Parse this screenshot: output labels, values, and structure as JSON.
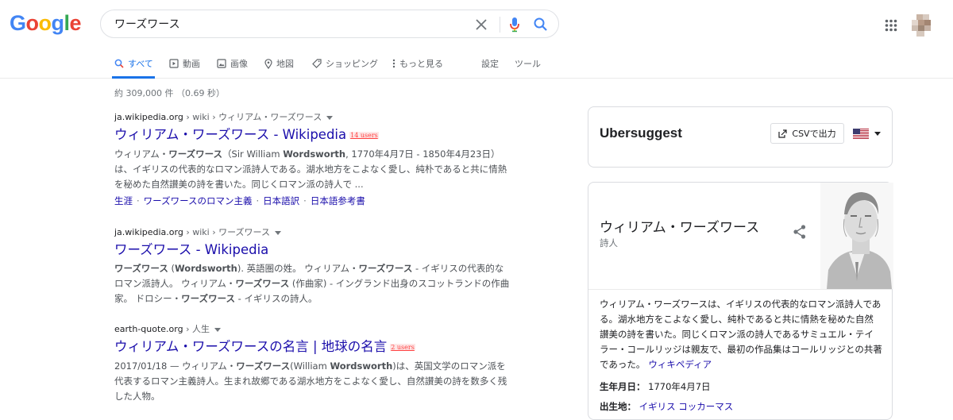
{
  "logo": {
    "letters": [
      "G",
      "o",
      "o",
      "g",
      "l",
      "e"
    ],
    "colors": [
      "#4285f4",
      "#ea4335",
      "#fbbc05",
      "#4285f4",
      "#34a853",
      "#ea4335"
    ]
  },
  "search": {
    "value": "ワーズワース"
  },
  "tabs": [
    {
      "label": "すべて",
      "icon": "search-icon",
      "active": true
    },
    {
      "label": "動画",
      "icon": "video-icon"
    },
    {
      "label": "画像",
      "icon": "image-icon"
    },
    {
      "label": "地図",
      "icon": "map-pin-icon"
    },
    {
      "label": "ショッピング",
      "icon": "tag-icon"
    },
    {
      "label": "もっと見る",
      "icon": "more-vert-icon"
    },
    {
      "label": "設定"
    },
    {
      "label": "ツール"
    }
  ],
  "stats": "約 309,000 件 （0.69 秒）",
  "results": [
    {
      "domain": "ja.wikipedia.org",
      "path": " › wiki › ウィリアム・ワーズワース",
      "title": "ウィリアム・ワーズワース - Wikipedia",
      "badge": "14 users",
      "snippet_html": "ウィリアム・<b>ワーズワース</b>（Sir William <b>Wordsworth</b>, 1770年4月7日 - 1850年4月23日）は、イギリスの代表的なロマン派詩人である。湖水地方をこよなく愛し、純朴であると共に情熱を秘めた自然讃美の詩を書いた。同じくロマン派の詩人で ...",
      "sitelinks": [
        "生涯",
        "ワーズワースのロマン主義",
        "日本語訳",
        "日本語参考書"
      ]
    },
    {
      "domain": "ja.wikipedia.org",
      "path": " › wiki › ワーズワース",
      "title": "ワーズワース - Wikipedia",
      "snippet_html": "<b>ワーズワース</b> (<b>Wordsworth</b>). 英語圏の姓。 ウィリアム・<b>ワーズワース</b> - イギリスの代表的なロマン派詩人。 ウィリアム・<b>ワーズワース</b> (作曲家) - イングランド出身のスコットランドの作曲家。 ドロシー・<b>ワーズワース</b> - イギリスの詩人。"
    },
    {
      "domain": "earth-quote.org",
      "path": " › 人生",
      "title": "ウィリアム・ワーズワースの名言 | 地球の名言",
      "badge": "2 users",
      "snippet_html": "2017/01/18 — ウィリアム・<b>ワーズワース</b>(William <b>Wordsworth</b>)は、英国文学のロマン派を代表するロマン主義詩人。生まれ故郷である湖水地方をこよなく愛し、自然讃美の詩を数多く残した人物。"
    }
  ],
  "ubersuggest": {
    "title": "Ubersuggest",
    "csv_label": "CSVで出力"
  },
  "knowledge_panel": {
    "name": "ウィリアム・ワーズワース",
    "subtitle": "詩人",
    "description": "ウィリアム・ワーズワースは、イギリスの代表的なロマン派詩人である。湖水地方をこよなく愛し、純朴であると共に情熱を秘めた自然讃美の詩を書いた。同じくロマン派の詩人であるサミュエル・テイラー・コールリッジは親友で、最初の作品集はコールリッジとの共著であった。",
    "source_link": "ウィキペディア",
    "facts": [
      {
        "label": "生年月日：",
        "value": "1770年4月7日"
      },
      {
        "label": "出生地：",
        "value": "イギリス コッカーマス",
        "link": true
      }
    ]
  }
}
